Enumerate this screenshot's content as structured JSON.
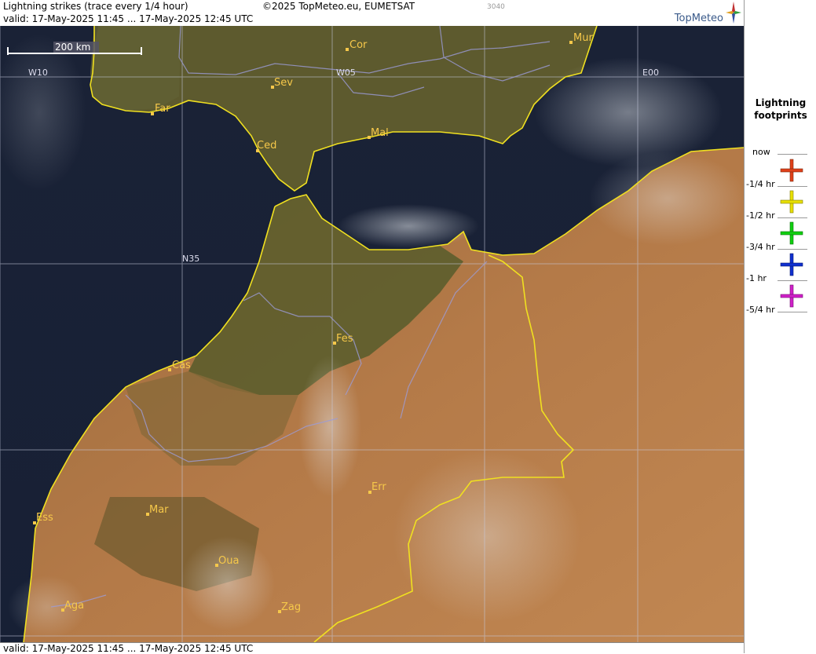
{
  "header": {
    "title": "Lightning strikes (trace every 1/4 hour)",
    "copyright": "©2025 TopMeteo.eu, EUMETSAT",
    "code": "3040",
    "valid": "valid:  17-May-2025 11:45 ... 17-May-2025 12:45 UTC",
    "brand": "TopMeteo"
  },
  "footer": {
    "valid": "valid:  17-May-2025 11:45 ... 17-May-2025 12:45 UTC"
  },
  "map": {
    "scale_label": "200 km",
    "grid_labels": {
      "w10": "W10",
      "w05": "W05",
      "e00": "E00",
      "n35": "N35"
    },
    "cities": {
      "cor": "Cor",
      "mur": "Mur",
      "sev": "Sev",
      "far": "Far",
      "ced": "Ced",
      "mal": "Mal",
      "fes": "Fes",
      "cas": "Cas",
      "err": "Err",
      "ess": "Ess",
      "mar": "Mar",
      "oua": "Oua",
      "aga": "Aga",
      "zag": "Zag"
    }
  },
  "legend": {
    "title_line1": "Lightning",
    "title_line2": "footprints",
    "items": [
      {
        "label": "now"
      },
      {
        "label": "-1/4 hr",
        "color": "#e0401a"
      },
      {
        "label": "-1/2 hr",
        "color": "#e8e000"
      },
      {
        "label": "-3/4 hr",
        "color": "#10d010"
      },
      {
        "label": "-1 hr",
        "color": "#1030d0"
      },
      {
        "label": "-5/4 hr",
        "color": "#d020c8"
      }
    ]
  }
}
